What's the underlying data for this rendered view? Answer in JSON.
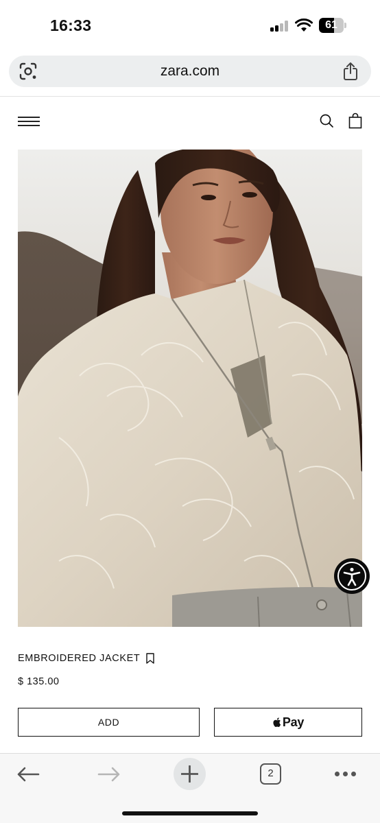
{
  "status_bar": {
    "time": "16:33",
    "battery_level": "61",
    "icons": [
      "cellular-signal-icon",
      "wifi-icon",
      "battery-icon"
    ]
  },
  "browser": {
    "url": "zara.com",
    "icons": [
      "google-lens-icon",
      "share-icon"
    ],
    "toolbar": {
      "tab_count": "2",
      "icons": [
        "back-arrow-icon",
        "forward-arrow-icon",
        "plus-icon",
        "tab-switcher-icon",
        "more-icon"
      ]
    }
  },
  "site_header": {
    "icons": [
      "menu-icon",
      "search-icon",
      "shopping-bag-icon"
    ]
  },
  "product": {
    "name": "EMBROIDERED JACKET",
    "price": "$ 135.00",
    "image_icon": "product-photo",
    "add_label": "ADD",
    "pay_label": "Pay",
    "pay_icon": "apple-logo-icon",
    "bookmark_icon": "bookmark-icon"
  },
  "accessibility": {
    "icon": "accessibility-person-icon"
  },
  "colors": {
    "accent": "#111111",
    "url_bar_bg": "#eceeef",
    "toolbar_bg": "#f7f7f7"
  }
}
